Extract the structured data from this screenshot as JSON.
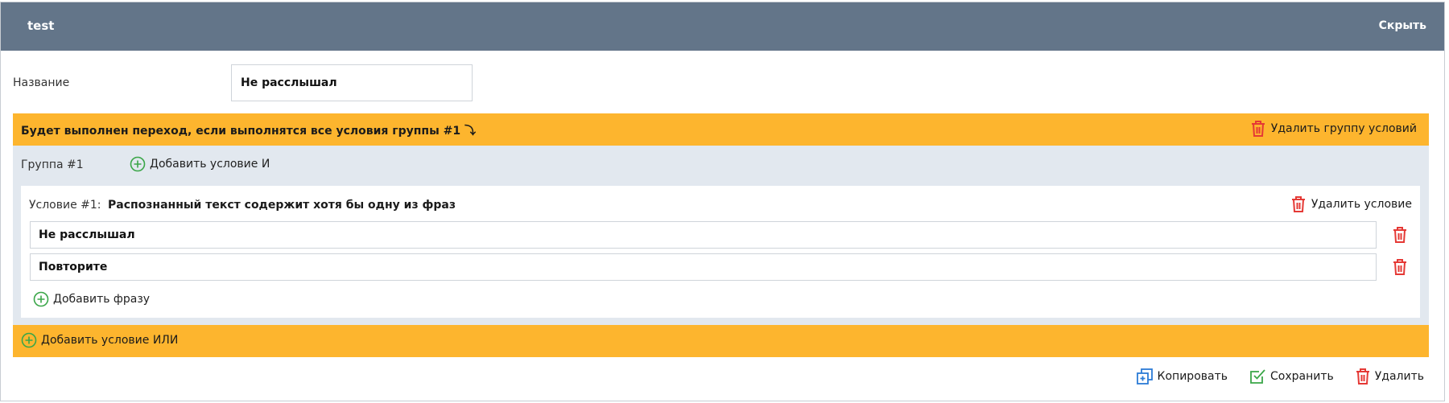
{
  "header": {
    "title": "test",
    "hide_label": "Скрыть"
  },
  "form": {
    "name_label": "Название",
    "name_value": "Не расслышал"
  },
  "condition_group": {
    "banner_text": "Будет выполнен переход, если выполнятся все условия группы #1 ⤵",
    "delete_group_label": "Удалить группу условий",
    "group_label": "Группа #1",
    "add_and_label": "Добавить условие И",
    "condition": {
      "label": "Условие #1:",
      "type": "Распознанный текст содержит хотя бы одну из фраз",
      "delete_label": "Удалить условие",
      "phrases": [
        "Не расслышал",
        "Повторите"
      ],
      "add_phrase_label": "Добавить фразу"
    },
    "add_or_label": "Добавить условие ИЛИ"
  },
  "footer": {
    "copy_label": "Копировать",
    "save_label": "Сохранить",
    "delete_label": "Удалить"
  },
  "colors": {
    "header_bg": "#637589",
    "accent_orange": "#fdb52e",
    "group_bg": "#e2e8ef",
    "danger_red": "#e53935",
    "add_green": "#3aa648",
    "copy_blue": "#2b7bd6"
  },
  "icons": {
    "trash": "trash-icon",
    "plus_circle": "plus-circle-icon",
    "copy": "copy-icon",
    "check": "check-icon"
  }
}
